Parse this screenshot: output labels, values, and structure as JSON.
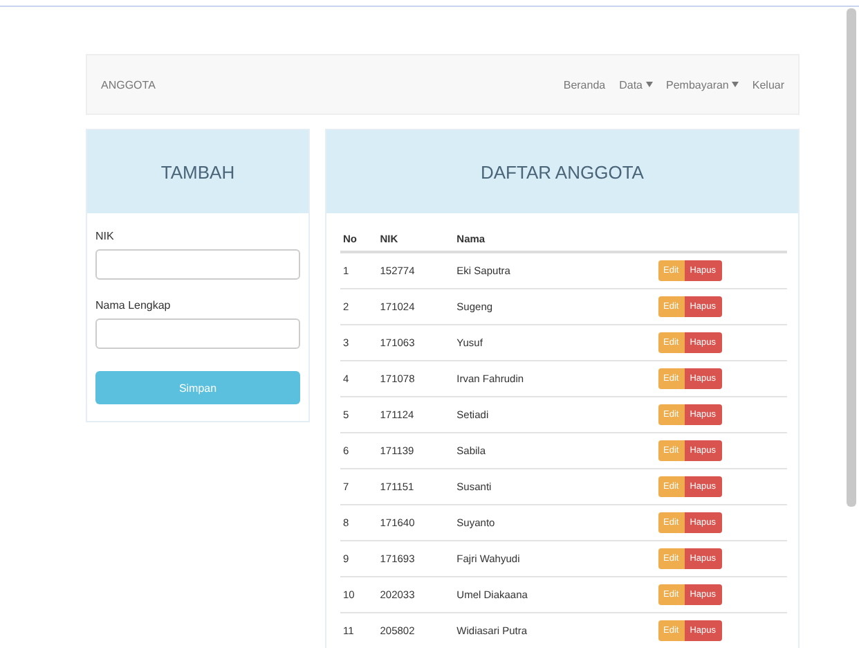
{
  "navbar": {
    "brand": "ANGGOTA",
    "items": [
      {
        "label": "Beranda",
        "dropdown": false
      },
      {
        "label": "Data",
        "dropdown": true
      },
      {
        "label": "Pembayaran",
        "dropdown": true
      },
      {
        "label": "Keluar",
        "dropdown": false
      }
    ]
  },
  "form": {
    "title": "TAMBAH",
    "fields": [
      {
        "label": "NIK"
      },
      {
        "label": "Nama Lengkap"
      }
    ],
    "submit": "Simpan"
  },
  "table": {
    "title": "DAFTAR ANGGOTA",
    "columns": [
      "No",
      "NIK",
      "Nama"
    ],
    "rows": [
      {
        "no": "1",
        "nik": "152774",
        "name": "Eki Saputra",
        "edit": "Edit",
        "delete": "Hapus"
      },
      {
        "no": "2",
        "nik": "171024",
        "name": "Sugeng",
        "edit": "Edit",
        "delete": "Hapus"
      },
      {
        "no": "3",
        "nik": "171063",
        "name": "Yusuf",
        "edit": "Edit",
        "delete": "Hapus"
      },
      {
        "no": "4",
        "nik": "171078",
        "name": "Irvan Fahrudin",
        "edit": "Edit",
        "delete": "Hapus"
      },
      {
        "no": "5",
        "nik": "171124",
        "name": "Setiadi",
        "edit": "Edit",
        "delete": "Hapus"
      },
      {
        "no": "6",
        "nik": "171139",
        "name": "Sabila",
        "edit": "Edit",
        "delete": "Hapus"
      },
      {
        "no": "7",
        "nik": "171151",
        "name": "Susanti",
        "edit": "Edit",
        "delete": "Hapus"
      },
      {
        "no": "8",
        "nik": "171640",
        "name": "Suyanto",
        "edit": "Edit",
        "delete": "Hapus"
      },
      {
        "no": "9",
        "nik": "171693",
        "name": "Fajri Wahyudi",
        "edit": "Edit",
        "delete": "Hapus"
      },
      {
        "no": "10",
        "nik": "202033",
        "name": "Umel Diakaana",
        "edit": "Edit",
        "delete": "Hapus"
      },
      {
        "no": "11",
        "nik": "205802",
        "name": "Widiasari Putra",
        "edit": "Edit",
        "delete": "Hapus"
      }
    ]
  }
}
